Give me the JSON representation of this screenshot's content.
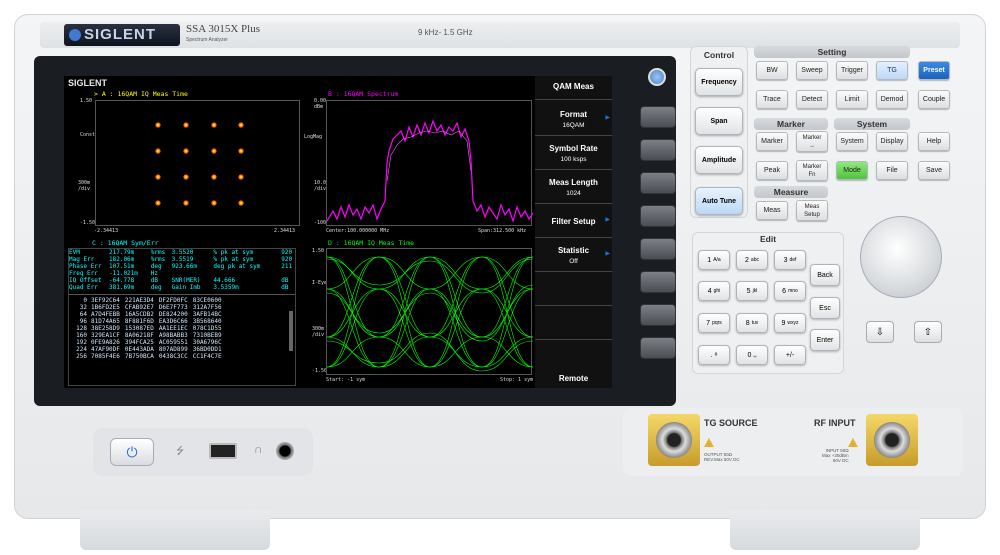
{
  "header": {
    "brand": "SIGLENT",
    "model": "SSA 3015X Plus",
    "subtitle": "Spectrum Analyzer",
    "freq_range": "9 kHz- 1.5 GHz"
  },
  "screen": {
    "logo": "SIGLENT",
    "trace_a": {
      "header": "> A : 16QAM IQ Meas Time",
      "ytop": "1.50",
      "ylabel": "Const",
      "ydiv": "300m\n/div",
      "ybot": "-1.50",
      "xleft": "-2.34413",
      "xright": "2.34413"
    },
    "trace_b": {
      "header": "B : 16QAM Spectrum",
      "ytop": "0.00\ndBm",
      "ylabel": "LogMag",
      "ydiv": "10.0\n/div",
      "ybot": "-100",
      "center": "Center:100.000000 MHz",
      "span": "Span:312.500 kHz"
    },
    "trace_c": {
      "header": "C : 16QAM Sym/Err"
    },
    "trace_d": {
      "header": "D : 16QAM IQ Meas Time",
      "ytop": "1.50",
      "ylabel": "I-Eye",
      "ydiv": "300m\n/div",
      "ybot": "-1.50",
      "start": "Start: -1 sym",
      "stop": "Stop: 1 sym"
    },
    "errors": [
      [
        "EVM",
        "217.79m",
        "%rms",
        "3.5520",
        "% pk at sym",
        "920"
      ],
      [
        "Mag Err",
        "182.06m",
        "%rms",
        "3.5519",
        "% pk at sym",
        "920"
      ],
      [
        "Phase Err",
        "107.51m",
        "deg",
        "923.66m",
        "deg pk at sym",
        "211"
      ],
      [
        "Freq Err",
        "-11.021m",
        "Hz",
        "",
        "",
        ""
      ],
      [
        "IQ Offset",
        "-64.778",
        "dB",
        "SNR(MER)",
        "44.666",
        "dB"
      ],
      [
        "Quad Err",
        "381.69m",
        "deg",
        "Gain Imb",
        "3.5359m",
        "dB"
      ]
    ],
    "symbols": [
      [
        "0",
        "3EF92C64",
        "221AE3D4",
        "DF2FD0FC",
        "83CE0600"
      ],
      [
        "32",
        "1B6FD2E5",
        "CFAB92E7",
        "D6E7F773",
        "312A7F56"
      ],
      [
        "64",
        "A7D4FEBB",
        "16A5CDB2",
        "DE824200",
        "3AFB14BC"
      ],
      [
        "96",
        "81D74A65",
        "8F881F6D",
        "EA3D6C66",
        "3B568640"
      ],
      [
        "128",
        "38E258D9",
        "153087ED",
        "AA1EE1EC",
        "078C1D55"
      ],
      [
        "160",
        "329EA1CF",
        "8A06218F",
        "A98BABB3",
        "7310BEB9"
      ],
      [
        "192",
        "0FE9A826",
        "394FCA25",
        "AC059551",
        "30A6796C"
      ],
      [
        "224",
        "47AF90DF",
        "0E443ADA",
        "807AD899",
        "36BD0DD1"
      ],
      [
        "256",
        "7085F4E6",
        "7B750BCA",
        "0438C3CC",
        "CC1F4C7E"
      ]
    ]
  },
  "menu": {
    "title": "QAM Meas",
    "items": [
      {
        "label": "Format",
        "value": "16QAM"
      },
      {
        "label": "Symbol Rate",
        "value": "100 ksps"
      },
      {
        "label": "Meas Length",
        "value": "1024"
      },
      {
        "label": "Filter Setup",
        "value": ""
      },
      {
        "label": "Statistic",
        "value": "Off"
      }
    ],
    "footer": "Remote"
  },
  "panel": {
    "control": {
      "title": "Control",
      "keys": [
        "Frequency",
        "Span",
        "Amplitude",
        "Auto Tune"
      ]
    },
    "setting": {
      "title": "Setting",
      "keys": [
        "BW",
        "Sweep",
        "Trigger",
        "TG",
        "Preset",
        "Trace",
        "Detect",
        "Limit",
        "Demod",
        "Couple"
      ]
    },
    "marker": {
      "title": "Marker",
      "keys": [
        "Marker",
        "Marker\n→",
        "Peak",
        "Marker\nFn"
      ]
    },
    "system": {
      "title": "System",
      "keys": [
        "System",
        "Display",
        "Help",
        "Mode",
        "File",
        "Save"
      ]
    },
    "measure": {
      "title": "Measure",
      "keys": [
        "Meas",
        "Meas\nSetup"
      ]
    },
    "edit": {
      "title": "Edit",
      "keys": [
        [
          "1",
          "A/a"
        ],
        [
          "2",
          "abc"
        ],
        [
          "3",
          "def"
        ],
        [
          "4",
          "ghi"
        ],
        [
          "5",
          "jkl"
        ],
        [
          "6",
          "mno"
        ],
        [
          "7",
          "pqrs"
        ],
        [
          "8",
          "tuv"
        ],
        [
          "9",
          "wxyz"
        ],
        [
          ".",
          "#"
        ],
        [
          "0",
          "␣"
        ],
        [
          "+/-",
          ""
        ]
      ],
      "side": [
        "Back",
        "Esc",
        "Enter"
      ]
    },
    "tg_source": {
      "title": "TG SOURCE",
      "warn": "OUTPUT 50Ω\nREV.Max 50V DC"
    },
    "rf_input": {
      "title": "RF INPUT",
      "warn": "INPUT 50Ω\nMax +30dBm\n50V DC"
    }
  },
  "colors": {
    "trace_a": "#ffff00",
    "trace_b": "#ff00ff",
    "trace_c": "#00ffff",
    "trace_d": "#00ff00",
    "preset": "#1c62c0",
    "mode": "#4fc43c"
  }
}
